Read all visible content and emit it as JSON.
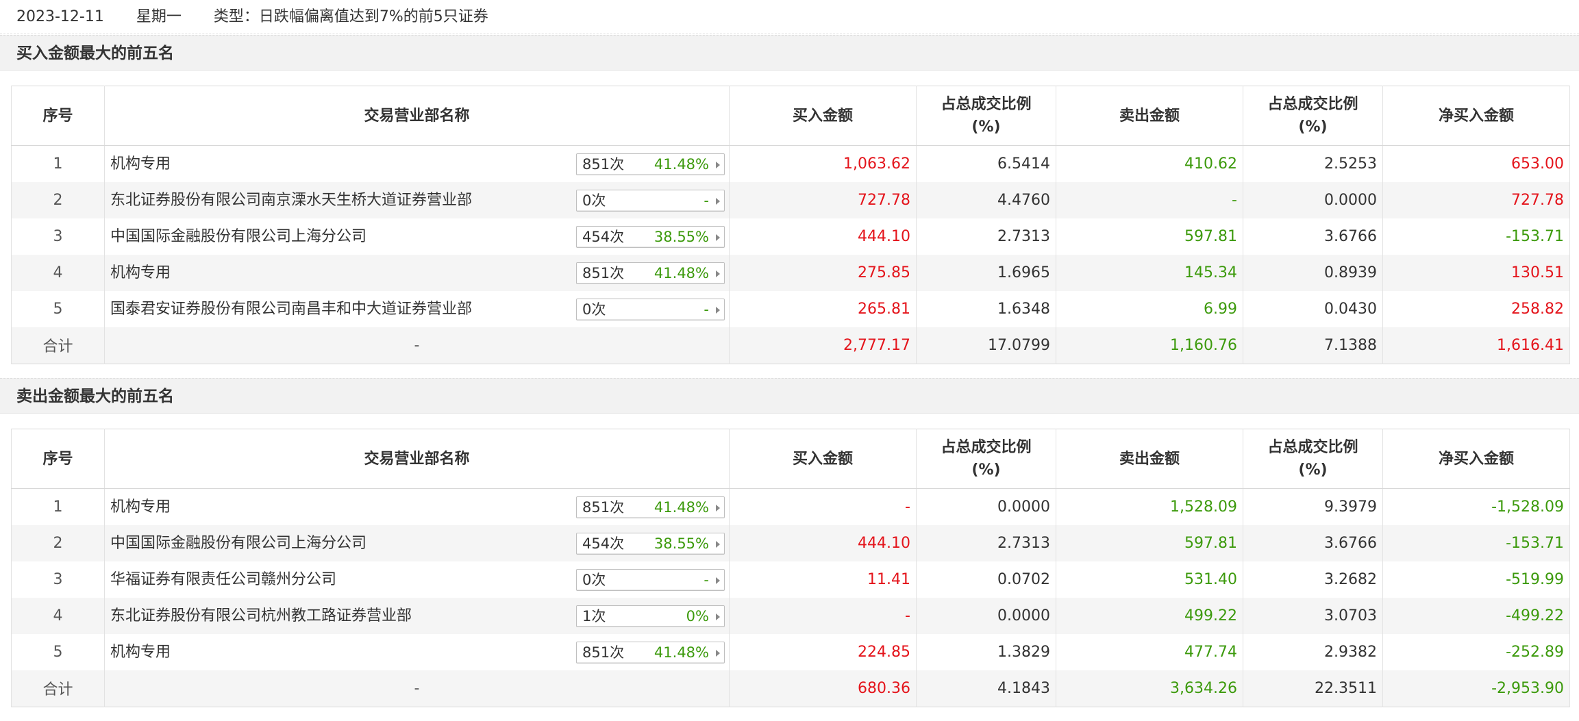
{
  "header": {
    "date": "2023-12-11",
    "weekday": "星期一",
    "type_label": "类型：日跌幅偏离值达到7%的前5只证券"
  },
  "columns": {
    "idx": "序号",
    "name": "交易营业部名称",
    "buy": "买入金额",
    "buy_ratio_line1": "占总成交比例",
    "buy_ratio_line2": "(%)",
    "sell": "卖出金额",
    "sell_ratio_line1": "占总成交比例",
    "sell_ratio_line2": "(%)",
    "net": "净买入金额"
  },
  "colors": {
    "red": "#e4141b",
    "green": "#3c9a0c",
    "arrow": "arrow-right-icon"
  },
  "buy_section": {
    "title": "买入金额最大的前五名",
    "rows": [
      {
        "idx": "1",
        "name": "机构专用",
        "count": "851次",
        "pct": "41.48%",
        "buy": "1,063.62",
        "buy_ratio": "6.5414",
        "sell": "410.62",
        "sell_ratio": "2.5253",
        "net": "653.00"
      },
      {
        "idx": "2",
        "name": "东北证券股份有限公司南京溧水天生桥大道证券营业部",
        "count": "0次",
        "pct": "-",
        "buy": "727.78",
        "buy_ratio": "4.4760",
        "sell": "-",
        "sell_ratio": "0.0000",
        "net": "727.78"
      },
      {
        "idx": "3",
        "name": "中国国际金融股份有限公司上海分公司",
        "count": "454次",
        "pct": "38.55%",
        "buy": "444.10",
        "buy_ratio": "2.7313",
        "sell": "597.81",
        "sell_ratio": "3.6766",
        "net": "-153.71"
      },
      {
        "idx": "4",
        "name": "机构专用",
        "count": "851次",
        "pct": "41.48%",
        "buy": "275.85",
        "buy_ratio": "1.6965",
        "sell": "145.34",
        "sell_ratio": "0.8939",
        "net": "130.51"
      },
      {
        "idx": "5",
        "name": "国泰君安证券股份有限公司南昌丰和中大道证券营业部",
        "count": "0次",
        "pct": "-",
        "buy": "265.81",
        "buy_ratio": "1.6348",
        "sell": "6.99",
        "sell_ratio": "0.0430",
        "net": "258.82"
      }
    ],
    "total": {
      "label": "合计",
      "name": "-",
      "buy": "2,777.17",
      "buy_ratio": "17.0799",
      "sell": "1,160.76",
      "sell_ratio": "7.1388",
      "net": "1,616.41"
    }
  },
  "sell_section": {
    "title": "卖出金额最大的前五名",
    "rows": [
      {
        "idx": "1",
        "name": "机构专用",
        "count": "851次",
        "pct": "41.48%",
        "buy": "-",
        "buy_ratio": "0.0000",
        "sell": "1,528.09",
        "sell_ratio": "9.3979",
        "net": "-1,528.09"
      },
      {
        "idx": "2",
        "name": "中国国际金融股份有限公司上海分公司",
        "count": "454次",
        "pct": "38.55%",
        "buy": "444.10",
        "buy_ratio": "2.7313",
        "sell": "597.81",
        "sell_ratio": "3.6766",
        "net": "-153.71"
      },
      {
        "idx": "3",
        "name": "华福证券有限责任公司赣州分公司",
        "count": "0次",
        "pct": "-",
        "buy": "11.41",
        "buy_ratio": "0.0702",
        "sell": "531.40",
        "sell_ratio": "3.2682",
        "net": "-519.99"
      },
      {
        "idx": "4",
        "name": "东北证券股份有限公司杭州教工路证券营业部",
        "count": "1次",
        "pct": "0%",
        "buy": "-",
        "buy_ratio": "0.0000",
        "sell": "499.22",
        "sell_ratio": "3.0703",
        "net": "-499.22"
      },
      {
        "idx": "5",
        "name": "机构专用",
        "count": "851次",
        "pct": "41.48%",
        "buy": "224.85",
        "buy_ratio": "1.3829",
        "sell": "477.74",
        "sell_ratio": "2.9382",
        "net": "-252.89"
      }
    ],
    "total": {
      "label": "合计",
      "name": "-",
      "buy": "680.36",
      "buy_ratio": "4.1843",
      "sell": "3,634.26",
      "sell_ratio": "22.3511",
      "net": "-2,953.90"
    }
  }
}
